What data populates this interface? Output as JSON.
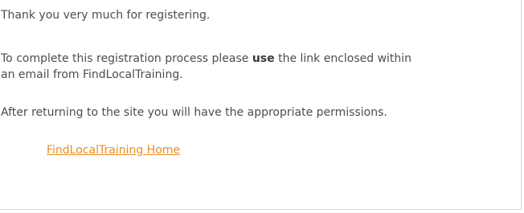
{
  "message": {
    "thanks": "Thank you very much for registering.",
    "instruction_before": "To complete this registration process please ",
    "instruction_bold": "use",
    "instruction_after": " the link enclosed within",
    "instruction_line2": "an email from FindLocalTraining.",
    "after_return": "After returning to the site you will have the appropriate permissions."
  },
  "links": {
    "home_label": "FindLocalTraining Home"
  },
  "colors": {
    "text": "#4d4d4d",
    "link": "#f08c1a",
    "border": "#d6d6d6",
    "background": "#ffffff"
  }
}
